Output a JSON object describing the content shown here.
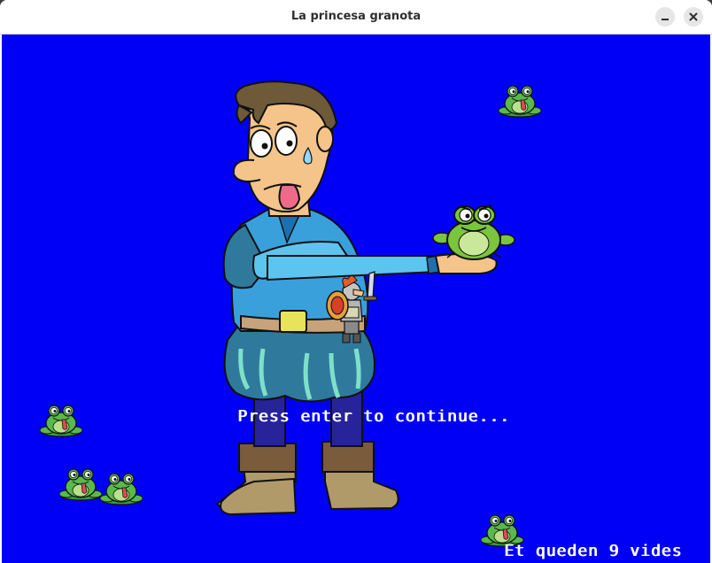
{
  "window": {
    "title": "La princesa granota",
    "minimize_icon": "minimize-icon",
    "close_icon": "close-icon"
  },
  "game": {
    "background_color": "#0000f6",
    "prompt": "Press enter to continue...",
    "lives_text": "Et queden 9 vides",
    "frog_sprite_count": 6,
    "sprites": [
      "prince",
      "frog",
      "knight",
      "frog-icon"
    ]
  }
}
